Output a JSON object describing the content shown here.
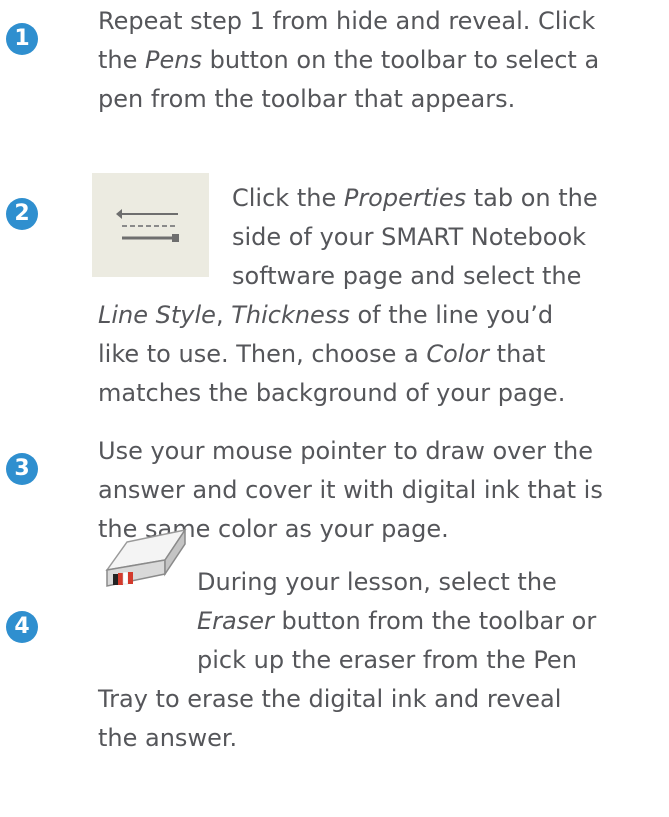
{
  "steps": [
    {
      "number": "1",
      "lines": [
        [
          "Repeat step 1 from hide and reveal. Click"
        ],
        [
          "the ",
          {
            "em": "Pens"
          },
          " button on the toolbar to select a"
        ],
        [
          "pen from the toolbar that appears."
        ]
      ],
      "icon": null
    },
    {
      "number": "2",
      "lines": [
        [
          "Click the ",
          {
            "em": "Properties"
          },
          " tab on the"
        ],
        [
          "side of your SMART Notebook"
        ],
        [
          "software page and select the"
        ],
        [
          {
            "em": "Line Style"
          },
          ", ",
          {
            "em": "Thickness"
          },
          " of the line you’d"
        ],
        [
          "like to use. Then, choose a ",
          {
            "em": "Color"
          },
          " that"
        ],
        [
          "matches the background of your page."
        ]
      ],
      "icon": "properties-tab-icon"
    },
    {
      "number": "3",
      "lines": [
        [
          "Use your mouse pointer to draw over the"
        ],
        [
          "answer and cover it with digital ink that is"
        ],
        [
          "the same color as your page."
        ]
      ],
      "icon": null
    },
    {
      "number": "4",
      "lines": [
        [
          "During your lesson, select the"
        ],
        [
          {
            "em": "Eraser"
          },
          " button from the toolbar or"
        ],
        [
          "pick up the eraser from the Pen"
        ],
        [
          "Tray to erase the digital ink and reveal"
        ],
        [
          "the answer."
        ]
      ],
      "icon": "eraser-icon"
    }
  ],
  "colors": {
    "badge": "#2f8fcf",
    "text": "#55565a"
  }
}
